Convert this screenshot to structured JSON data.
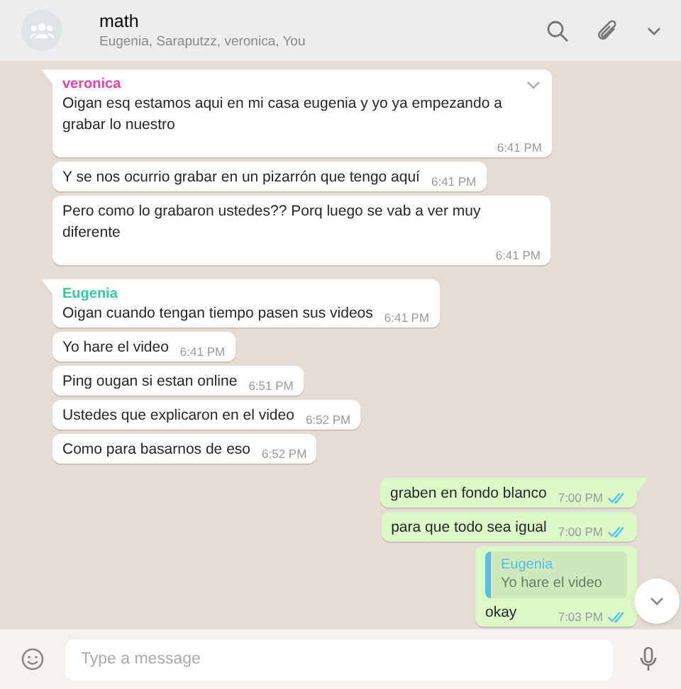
{
  "header": {
    "title": "math",
    "subtitle": "Eugenia, Saraputzz, veronica, You"
  },
  "messages": [
    {
      "kind": "incoming",
      "sender": "veronica",
      "color": "#e542a3",
      "text": "Oigan esq estamos aqui en mi casa eugenia y yo ya empezando a grabar lo nuestro",
      "time": "6:41 PM",
      "menu": true,
      "tail": true
    },
    {
      "kind": "incoming",
      "text": "Y se nos ocurrio grabar en un pizarrón que tengo aquí",
      "time": "6:41 PM"
    },
    {
      "kind": "incoming",
      "text": "Pero como lo grabaron ustedes?? Porq luego se vab a ver muy diferente",
      "time": "6:41 PM",
      "wide": true
    },
    {
      "kind": "incoming",
      "sender": "Eugenia",
      "color": "#35cd96",
      "text": "Oigan cuando tengan tiempo pasen sus videos",
      "time": "6:41 PM",
      "tail": true
    },
    {
      "kind": "incoming",
      "text": "Yo hare el video",
      "time": "6:41 PM"
    },
    {
      "kind": "incoming",
      "text": "Ping ougan si estan online",
      "time": "6:51 PM"
    },
    {
      "kind": "incoming",
      "text": "Ustedes que explicaron en el video",
      "time": "6:52 PM"
    },
    {
      "kind": "incoming",
      "text": "Como para basarnos de eso",
      "time": "6:52 PM"
    },
    {
      "kind": "outgoing",
      "text": "graben en fondo blanco",
      "time": "7:00 PM",
      "read": true,
      "tail": true
    },
    {
      "kind": "outgoing",
      "text": "para que todo sea igual",
      "time": "7:00 PM",
      "read": true
    },
    {
      "kind": "outgoing",
      "quote": {
        "sender": "Eugenia",
        "color": "#53bdeb",
        "text": "Yo hare el video"
      },
      "text": "okay",
      "time": "7:03 PM",
      "read": true
    }
  ],
  "composer": {
    "placeholder": "Type a message"
  }
}
